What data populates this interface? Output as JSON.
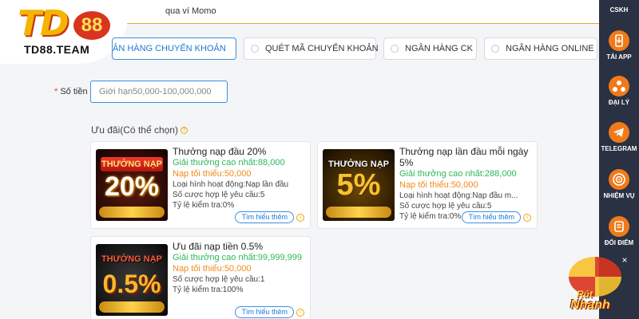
{
  "header": {
    "hint": "qua ví Momo"
  },
  "logo": {
    "mark": "TD",
    "badge": "88",
    "brand": "TD88.TEAM"
  },
  "tabs": [
    {
      "label": "ÂN HÀNG CHUYỂN KHOẢN",
      "selected": true
    },
    {
      "label": "QUÉT MÃ CHUYỂN KHOẢN",
      "selected": false
    },
    {
      "label": "NGÂN HÀNG CK",
      "selected": false
    },
    {
      "label": "NGÂN HÀNG ONLINE",
      "selected": false
    }
  ],
  "amount": {
    "label": "Số tiền",
    "required_mark": "*",
    "placeholder": "Giới hạn50,000-100,000,000",
    "value": ""
  },
  "promotions": {
    "title": "Ưu đãi(Có thể chọn)",
    "help_icon": "?",
    "cards": [
      {
        "banner_ribbon": "THƯỞNG NẠP",
        "banner_value": "20%",
        "title": "Thưởng nạp đầu 20%",
        "max_bonus": "Giải thưởng cao nhất:88,000",
        "min_deposit": "Nạp tối thiểu:50,000",
        "activity": "Loại hình hoạt động:Nạp lần đầu",
        "wager": "Số cược hợp lệ yêu cầu:5",
        "check_rate": "Tỷ lệ kiểm tra:0%",
        "more_label": "Tìm hiểu thêm",
        "info_icon": "i"
      },
      {
        "banner_ribbon": "THƯỞNG NẠP",
        "banner_value": "5%",
        "title": "Thưởng nạp lần đầu mỗi ngày 5%",
        "max_bonus": "Giải thưởng cao nhất:288,000",
        "min_deposit": "Nạp tối thiểu:50,000",
        "activity": "Loại hình hoạt động:Nạp đầu m...",
        "wager": "Số cược hợp lệ yêu cầu:5",
        "check_rate": "Tỷ lệ kiểm tra:0%",
        "more_label": "Tìm hiểu thêm",
        "info_icon": "i"
      },
      {
        "banner_ribbon": "THƯỞNG NẠP",
        "banner_value": "0.5%",
        "title": "Ưu đãi nạp tiền 0.5%",
        "max_bonus": "Giải thưởng cao nhất:99,999,999",
        "min_deposit": "Nạp tối thiểu:50,000",
        "wager": "Số cược hợp lệ yêu cầu:1",
        "check_rate": "Tỷ lệ kiểm tra:100%",
        "more_label": "Tìm hiểu thêm",
        "info_icon": "i"
      }
    ]
  },
  "sidebar": {
    "items": [
      {
        "label": "CSKH",
        "icon": "headset-icon"
      },
      {
        "label": "TẢI APP",
        "icon": "mobile-download-icon"
      },
      {
        "label": "ĐẠI LÝ",
        "icon": "agent-network-icon"
      },
      {
        "label": "TELEGRAM",
        "icon": "telegram-icon"
      },
      {
        "label": "NHIỆM VỤ",
        "icon": "mission-target-icon"
      },
      {
        "label": "ĐỔI ĐIỂM",
        "icon": "exchange-points-icon"
      }
    ],
    "close_glyph": "×"
  },
  "rut_nhanh": {
    "line1": "Rút",
    "line2": "Nhanh"
  },
  "colors": {
    "accent_blue": "#3b8fe0",
    "bonus_green": "#2fb75a",
    "deposit_orange": "#f08a1c",
    "sidebar_bg": "#2a3142",
    "logo_gold": "#f5b400"
  }
}
